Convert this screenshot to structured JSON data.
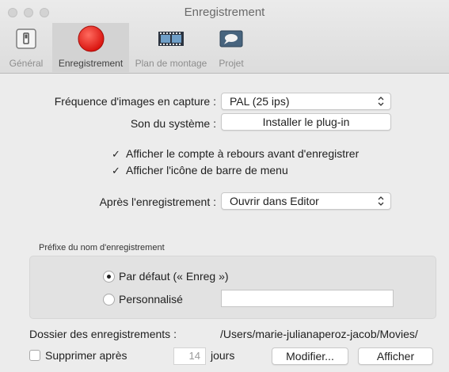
{
  "window": {
    "title": "Enregistrement"
  },
  "toolbar": {
    "tabs": [
      {
        "label": "Général",
        "icon": "switch-icon",
        "active": false
      },
      {
        "label": "Enregistrement",
        "icon": "record-icon",
        "active": true
      },
      {
        "label": "Plan de montage",
        "icon": "filmstrip-icon",
        "active": false
      },
      {
        "label": "Projet",
        "icon": "project-icon",
        "active": false
      }
    ]
  },
  "capture": {
    "frame_rate_label": "Fréquence d'images en capture :",
    "frame_rate_value": "PAL (25 ips)",
    "system_audio_label": "Son du système :",
    "system_audio_button": "Installer le plug-in"
  },
  "options": {
    "countdown_label": "Afficher le compte à rebours avant d'enregistrer",
    "countdown_checked": true,
    "menubar_label": "Afficher l'icône de barre de menu",
    "menubar_checked": true
  },
  "after_recording": {
    "label": "Après l'enregistrement :",
    "value": "Ouvrir dans Editor"
  },
  "prefix": {
    "group_title": "Préfixe du nom d'enregistrement",
    "default_label": "Par défaut (« Enreg »)",
    "default_selected": true,
    "custom_label": "Personnalisé",
    "custom_value": ""
  },
  "folder": {
    "label": "Dossier des enregistrements :",
    "path": "/Users/marie-julianaperoz-jacob/Movies/"
  },
  "cleanup": {
    "delete_label": "Supprimer après",
    "delete_checked": false,
    "days_value": "14",
    "days_unit": "jours",
    "modify_button": "Modifier...",
    "show_button": "Afficher"
  },
  "colors": {
    "record_red": "#e8231f",
    "window_bg": "#ececec"
  }
}
